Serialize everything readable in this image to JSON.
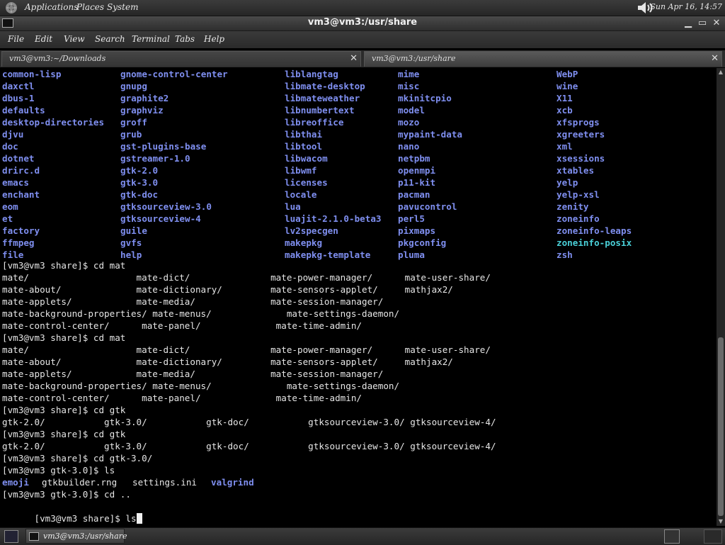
{
  "top_panel": {
    "menus": [
      "Applications",
      "Places",
      "System"
    ],
    "clock": "Sun Apr 16, 14:57",
    "volume_icon": "speaker-volume-icon"
  },
  "window": {
    "title": "vm3@vm3:/usr/share",
    "buttons": [
      "minimize-icon",
      "maximize-icon",
      "close-icon"
    ]
  },
  "menubar": [
    "File",
    "Edit",
    "View",
    "Search",
    "Terminal",
    "Tabs",
    "Help"
  ],
  "tabs": [
    {
      "label": "vm3@vm3:~/Downloads",
      "active": false
    },
    {
      "label": "vm3@vm3:/usr/share",
      "active": true
    }
  ],
  "terminal": {
    "ls_columns": [
      [
        "common-lisp",
        "daxctl",
        "dbus-1",
        "defaults",
        "desktop-directories",
        "djvu",
        "doc",
        "dotnet",
        "drirc.d",
        "emacs",
        "enchant",
        "eom",
        "et",
        "factory",
        "ffmpeg",
        "file"
      ],
      [
        "gnome-control-center",
        "gnupg",
        "graphite2",
        "graphviz",
        "groff",
        "grub",
        "gst-plugins-base",
        "gstreamer-1.0",
        "gtk-2.0",
        "gtk-3.0",
        "gtk-doc",
        "gtksourceview-3.0",
        "gtksourceview-4",
        "guile",
        "gvfs",
        "help"
      ],
      [
        "liblangtag",
        "libmate-desktop",
        "libmateweather",
        "libnumbertext",
        "libreoffice",
        "libthai",
        "libtool",
        "libwacom",
        "libwmf",
        "licenses",
        "locale",
        "lua",
        "luajit-2.1.0-beta3",
        "lv2specgen",
        "makepkg",
        "makepkg-template"
      ],
      [
        "mime",
        "misc",
        "mkinitcpio",
        "model",
        "mozo",
        "mypaint-data",
        "nano",
        "netpbm",
        "openmpi",
        "p11-kit",
        "pacman",
        "pavucontrol",
        "perl5",
        "pixmaps",
        "pkgconfig",
        "pluma"
      ],
      [
        "WebP",
        "wine",
        "X11",
        "xcb",
        "xfsprogs",
        "xgreeters",
        "xml",
        "xsessions",
        "xtables",
        "yelp",
        "yelp-xsl",
        "zenity",
        "zoneinfo",
        "zoneinfo-leaps",
        "zoneinfo-posix",
        "zsh"
      ]
    ],
    "symlink_entry": "zoneinfo-posix",
    "lines": [
      "[vm3@vm3 share]$ cd mat",
      "mate/                    mate-dict/               mate-power-manager/      mate-user-share/",
      "mate-about/              mate-dictionary/         mate-sensors-applet/     mathjax2/",
      "mate-applets/            mate-media/              mate-session-manager/",
      "mate-background-properties/ mate-menus/              mate-settings-daemon/",
      "mate-control-center/      mate-panel/              mate-time-admin/",
      "[vm3@vm3 share]$ cd mat",
      "mate/                    mate-dict/               mate-power-manager/      mate-user-share/",
      "mate-about/              mate-dictionary/         mate-sensors-applet/     mathjax2/",
      "mate-applets/            mate-media/              mate-session-manager/",
      "mate-background-properties/ mate-menus/              mate-settings-daemon/",
      "mate-control-center/      mate-panel/              mate-time-admin/",
      "[vm3@vm3 share]$ cd gtk",
      "gtk-2.0/           gtk-3.0/           gtk-doc/           gtksourceview-3.0/ gtksourceview-4/",
      "[vm3@vm3 share]$ cd gtk",
      "gtk-2.0/           gtk-3.0/           gtk-doc/           gtksourceview-3.0/ gtksourceview-4/",
      "[vm3@vm3 share]$ cd gtk-3.0/",
      "[vm3@vm3 gtk-3.0]$ ls"
    ],
    "gtk3_listing": [
      "emoji",
      "gtkbuilder.rng",
      "settings.ini",
      "valgrind"
    ],
    "after_lines": [
      "[vm3@vm3 gtk-3.0]$ cd .."
    ],
    "current_prompt": "[vm3@vm3 share]$ ls"
  },
  "taskbar": {
    "task_label": "vm3@vm3:/usr/share",
    "show_desktop_icon": "show-desktop-icon",
    "workspace_icons": [
      "workspace-1-icon",
      "workspace-2-icon"
    ]
  },
  "colors": {
    "directory": "#7f8ff0",
    "symlink": "#4ad0d8",
    "text": "#e6e6e6",
    "background": "#000000"
  }
}
